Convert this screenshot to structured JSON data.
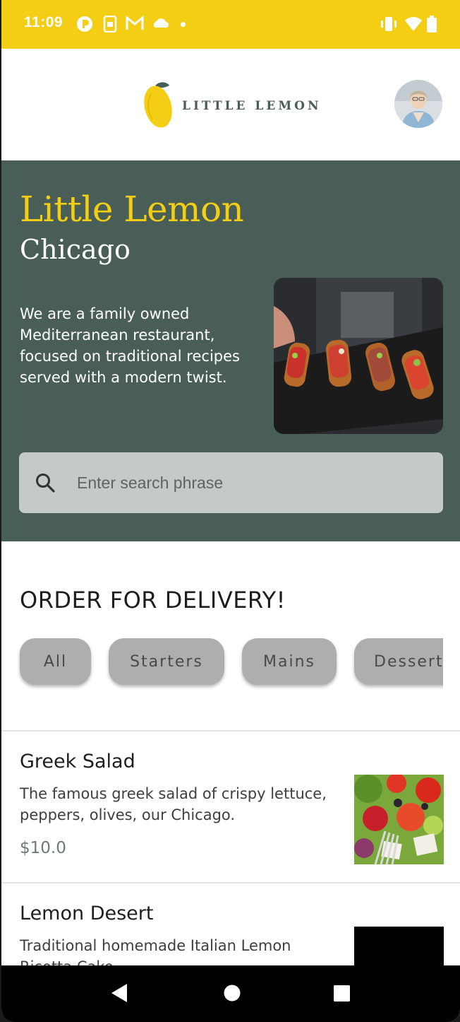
{
  "status_bar": {
    "time": "11:09",
    "icons": [
      "notification-app-icon",
      "sim-toolkit-icon",
      "gmail-icon",
      "cloud-icon",
      "dot-icon",
      "vibrate-icon",
      "wifi-icon",
      "battery-icon"
    ],
    "background": "#f4ce14"
  },
  "app_bar": {
    "logo_text": "LITTLE LEMON",
    "avatar": "profile-avatar"
  },
  "hero": {
    "title": "Little Lemon",
    "city": "Chicago",
    "description": "We are a family owned Mediterranean restaurant, focused on traditional recipes served with a modern twist.",
    "image": "bruschetta-platter",
    "search_placeholder": "Enter search phrase"
  },
  "delivery": {
    "title": "ORDER FOR DELIVERY!",
    "categories": [
      "All",
      "Starters",
      "Mains",
      "Desserts"
    ]
  },
  "menu_items": [
    {
      "name": "Greek Salad",
      "description": "The famous greek salad of crispy lettuce, peppers, olives, our Chicago.",
      "price": "$10.0",
      "image": "greek-salad"
    },
    {
      "name": "Lemon Desert",
      "description": "Traditional homemade Italian Lemon Ricotta Cake.",
      "image": "lemon-dessert"
    }
  ],
  "nav_bar": {
    "buttons": [
      "back",
      "home",
      "recents"
    ]
  },
  "colors": {
    "primary_green": "#495e57",
    "primary_yellow": "#f4ce14",
    "chip": "#aeaeae"
  }
}
